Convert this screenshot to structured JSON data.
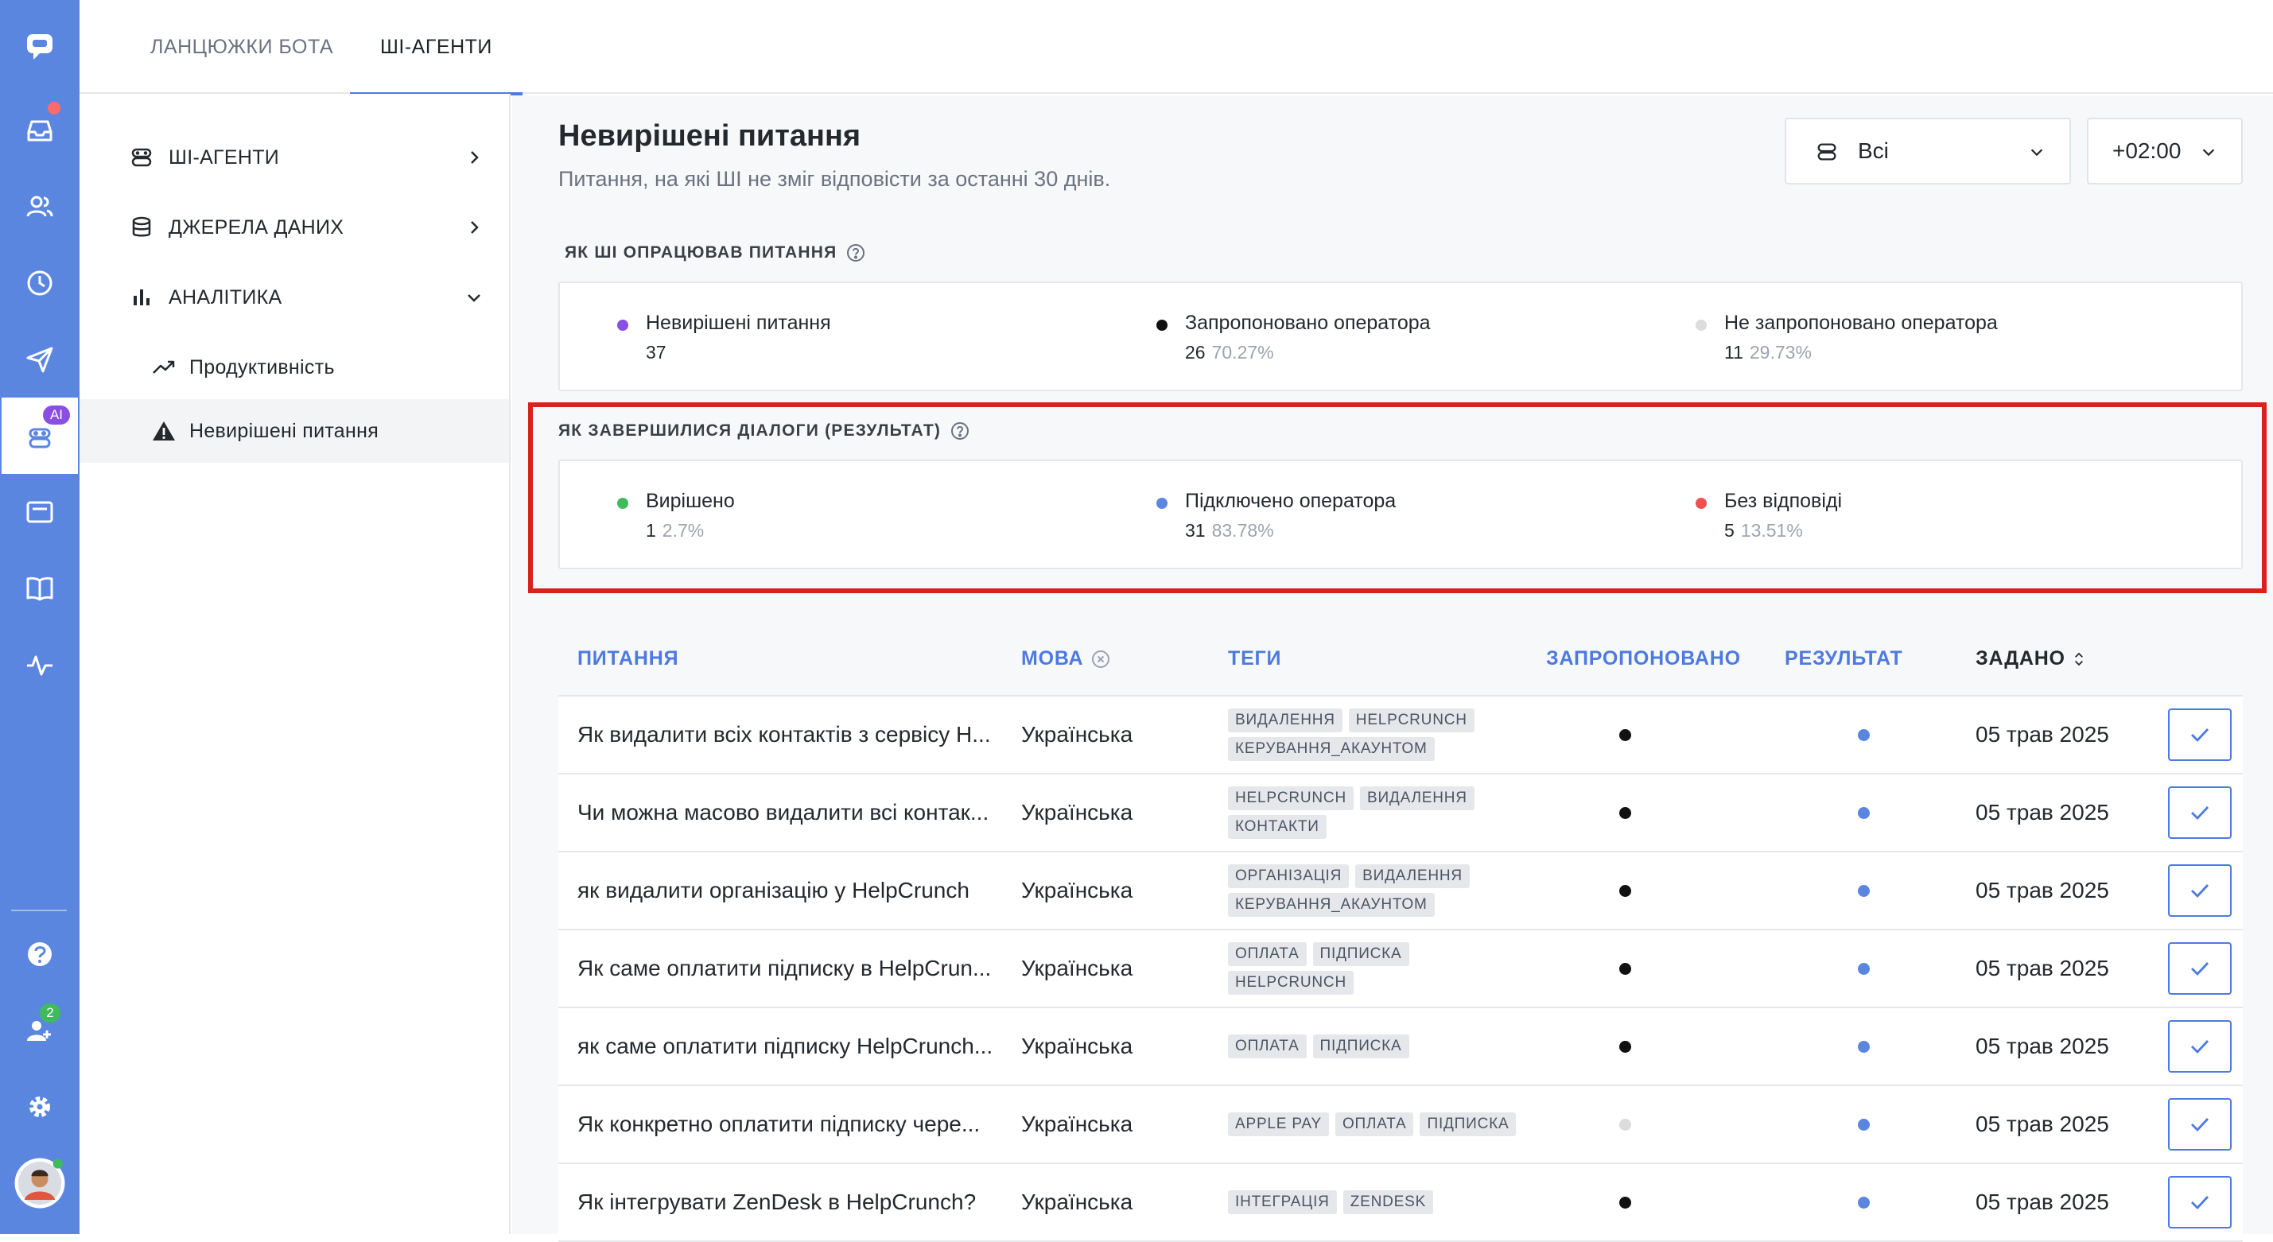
{
  "rail": {
    "icons": [
      "chat-logo-icon",
      "inbox-icon",
      "contacts-icon",
      "history-icon",
      "send-icon",
      "ai-agent-icon",
      "card-icon",
      "book-icon",
      "activity-icon",
      "help-icon",
      "team-icon",
      "settings-icon",
      "user-avatar"
    ],
    "ai_badge": "AI",
    "team_badge": "2"
  },
  "top_tabs": [
    {
      "label": "ЛАНЦЮЖКИ БОТА",
      "active": false
    },
    {
      "label": "ШІ-АГЕНТИ",
      "active": true
    }
  ],
  "sidenav": {
    "items": [
      {
        "label": "ШІ-АГЕНТИ",
        "icon": "bot-icon"
      },
      {
        "label": "ДЖЕРЕЛА ДАНИХ",
        "icon": "database-icon"
      },
      {
        "label": "АНАЛІТИКА",
        "icon": "bar-chart-icon"
      }
    ],
    "sub_items": [
      {
        "label": "Продуктивність",
        "icon": "trend-up-icon",
        "active": false
      },
      {
        "label": "Невирішені питання",
        "icon": "warning-icon",
        "active": true
      }
    ]
  },
  "header": {
    "title": "Невирішені питання",
    "subtitle": "Питання, на які ШІ не зміг відповісти за останні 30 днів.",
    "agent_filter": "Всі",
    "timezone": "+02:00"
  },
  "processing": {
    "label": "ЯК ШІ ОПРАЦЮВАВ ПИТАННЯ",
    "stats": [
      {
        "name": "Невирішені питання",
        "value": "37",
        "pct": "",
        "color": "#8a4fe0"
      },
      {
        "name": "Запропоновано оператора",
        "value": "26",
        "pct": "70.27%",
        "color": "#111111"
      },
      {
        "name": "Не запропоновано оператора",
        "value": "11",
        "pct": "29.73%",
        "color": "#dcdcdc"
      }
    ]
  },
  "results": {
    "label": "ЯК ЗАВЕРШИЛИСЯ ДІАЛОГИ (РЕЗУЛЬТАТ)",
    "stats": [
      {
        "name": "Вирішено",
        "value": "1",
        "pct": "2.7%",
        "color": "#3dbb5d"
      },
      {
        "name": "Підключено оператора",
        "value": "31",
        "pct": "83.78%",
        "color": "#5a86e0"
      },
      {
        "name": "Без відповіді",
        "value": "5",
        "pct": "13.51%",
        "color": "#f05252"
      }
    ]
  },
  "table": {
    "headers": {
      "question": "ПИТАННЯ",
      "language": "МОВА",
      "tags": "ТЕГИ",
      "offered": "ЗАПРОПОНОВАНО",
      "result": "РЕЗУЛЬТАТ",
      "asked": "ЗАДАНО"
    },
    "rows": [
      {
        "question": "Як видалити всіх контактів з сервісу H...",
        "language": "Українська",
        "tags": [
          "ВИДАЛЕННЯ",
          "HELPCRUNCH",
          "КЕРУВАННЯ_АКАУНТОМ"
        ],
        "offered": true,
        "result_color": "#5a86e0",
        "date": "05 трав 2025"
      },
      {
        "question": "Чи можна масово видалити всі контак...",
        "language": "Українська",
        "tags": [
          "HELPCRUNCH",
          "ВИДАЛЕННЯ",
          "КОНТАКТИ"
        ],
        "offered": true,
        "result_color": "#5a86e0",
        "date": "05 трав 2025"
      },
      {
        "question": "як видалити організацію у HelpCrunch",
        "language": "Українська",
        "tags": [
          "ОРГАНІЗАЦІЯ",
          "ВИДАЛЕННЯ",
          "КЕРУВАННЯ_АКАУНТОМ"
        ],
        "offered": true,
        "result_color": "#5a86e0",
        "date": "05 трав 2025"
      },
      {
        "question": "Як саме оплатити підписку в HelpCrun...",
        "language": "Українська",
        "tags": [
          "ОПЛАТА",
          "ПІДПИСКА",
          "HELPCRUNCH"
        ],
        "offered": true,
        "result_color": "#5a86e0",
        "date": "05 трав 2025"
      },
      {
        "question": "як саме оплатити підписку HelpCrunch...",
        "language": "Українська",
        "tags": [
          "ОПЛАТА",
          "ПІДПИСКА"
        ],
        "offered": true,
        "result_color": "#5a86e0",
        "date": "05 трав 2025"
      },
      {
        "question": "Як конкретно оплатити підписку чере...",
        "language": "Українська",
        "tags": [
          "APPLE PAY",
          "ОПЛАТА",
          "ПІДПИСКА"
        ],
        "offered": false,
        "result_color": "#5a86e0",
        "date": "05 трав 2025"
      },
      {
        "question": "Як інтегрувати ZenDesk в HelpCrunch?",
        "language": "Українська",
        "tags": [
          "ІНТЕГРАЦІЯ",
          "ZENDESK"
        ],
        "offered": true,
        "result_color": "#5a86e0",
        "date": "05 трав 2025"
      }
    ]
  }
}
